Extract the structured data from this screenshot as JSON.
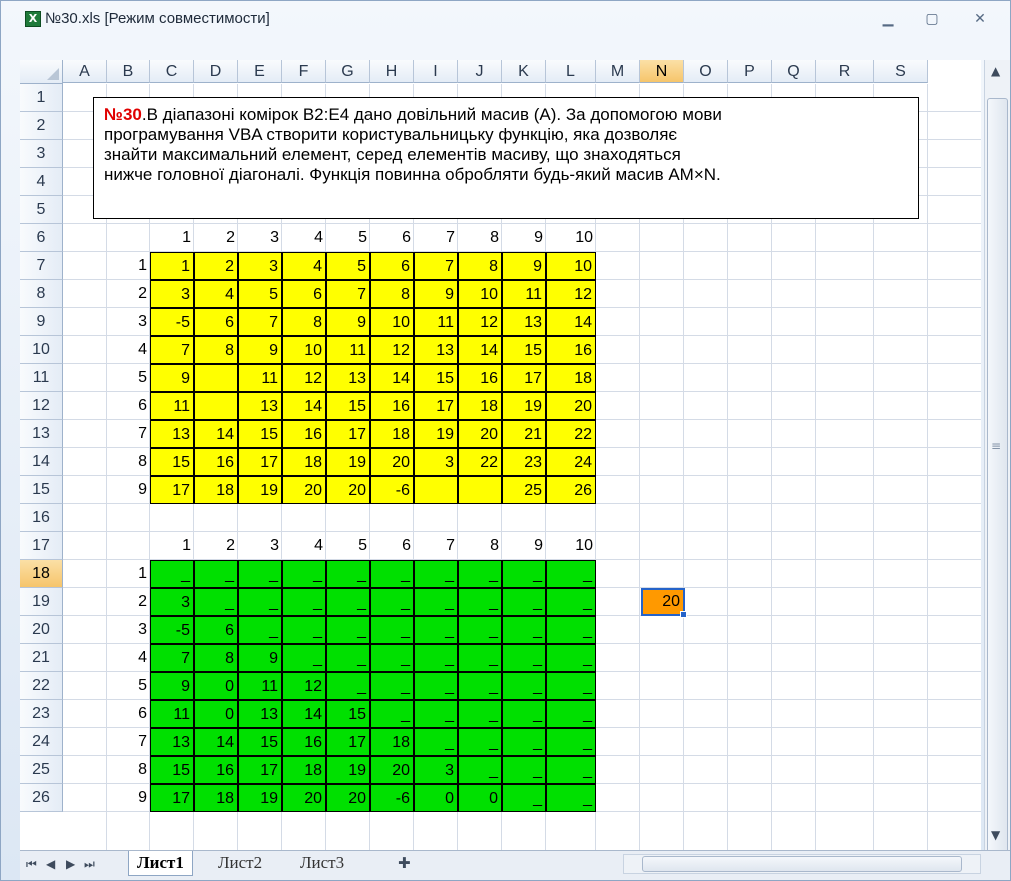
{
  "window": {
    "title": "№30.xls  [Режим совместимости]",
    "minimize_glyph": "▁",
    "maximize_glyph": "▢",
    "close_glyph": "✕"
  },
  "columns": [
    "A",
    "B",
    "C",
    "D",
    "E",
    "F",
    "G",
    "H",
    "I",
    "J",
    "K",
    "L",
    "M",
    "N",
    "O",
    "P",
    "Q",
    "R",
    "S"
  ],
  "rows": [
    "1",
    "2",
    "3",
    "4",
    "5",
    "6",
    "7",
    "8",
    "9",
    "10",
    "11",
    "12",
    "13",
    "14",
    "15",
    "16",
    "17",
    "18",
    "19",
    "20",
    "21",
    "22",
    "23",
    "24",
    "25",
    "26"
  ],
  "selected_column": "N",
  "selected_row": "18",
  "task": {
    "number": "№30",
    "text_line1": ".В діапазоні комірок B2:E4 дано довільний масив (A). За допомогою мови",
    "text_line2": "програмування VBA створити користувальницьку функцію, яка дозволяє",
    "text_line3": "знайти максимальний елемент, серед елементів масиву, що знаходяться",
    "text_line4": "нижче головної діагоналі. Функція повинна обробляти будь-який масив AM×N."
  },
  "table1": {
    "col_headers": [
      "1",
      "2",
      "3",
      "4",
      "5",
      "6",
      "7",
      "8",
      "9",
      "10"
    ],
    "row_headers": [
      "1",
      "2",
      "3",
      "4",
      "5",
      "6",
      "7",
      "8",
      "9"
    ],
    "cells": [
      [
        "1",
        "2",
        "3",
        "4",
        "5",
        "6",
        "7",
        "8",
        "9",
        "10"
      ],
      [
        "3",
        "4",
        "5",
        "6",
        "7",
        "8",
        "9",
        "10",
        "11",
        "12"
      ],
      [
        "-5",
        "6",
        "7",
        "8",
        "9",
        "10",
        "11",
        "12",
        "13",
        "14"
      ],
      [
        "7",
        "8",
        "9",
        "10",
        "11",
        "12",
        "13",
        "14",
        "15",
        "16"
      ],
      [
        "9",
        "",
        "11",
        "12",
        "13",
        "14",
        "15",
        "16",
        "17",
        "18"
      ],
      [
        "11",
        "",
        "13",
        "14",
        "15",
        "16",
        "17",
        "18",
        "19",
        "20"
      ],
      [
        "13",
        "14",
        "15",
        "16",
        "17",
        "18",
        "19",
        "20",
        "21",
        "22"
      ],
      [
        "15",
        "16",
        "17",
        "18",
        "19",
        "20",
        "3",
        "22",
        "23",
        "24"
      ],
      [
        "17",
        "18",
        "19",
        "20",
        "20",
        "-6",
        "",
        "",
        "25",
        "26"
      ]
    ]
  },
  "table2": {
    "col_headers": [
      "1",
      "2",
      "3",
      "4",
      "5",
      "6",
      "7",
      "8",
      "9",
      "10"
    ],
    "row_headers": [
      "1",
      "2",
      "3",
      "4",
      "5",
      "6",
      "7",
      "8",
      "9"
    ],
    "cells": [
      [
        "_",
        "_",
        "_",
        "_",
        "_",
        "_",
        "_",
        "_",
        "_",
        "_"
      ],
      [
        "3",
        "_",
        "_",
        "_",
        "_",
        "_",
        "_",
        "_",
        "_",
        "_"
      ],
      [
        "-5",
        "6",
        "_",
        "_",
        "_",
        "_",
        "_",
        "_",
        "_",
        "_"
      ],
      [
        "7",
        "8",
        "9",
        "_",
        "_",
        "_",
        "_",
        "_",
        "_",
        "_"
      ],
      [
        "9",
        "0",
        "11",
        "12",
        "_",
        "_",
        "_",
        "_",
        "_",
        "_"
      ],
      [
        "11",
        "0",
        "13",
        "14",
        "15",
        "_",
        "_",
        "_",
        "_",
        "_"
      ],
      [
        "13",
        "14",
        "15",
        "16",
        "17",
        "18",
        "_",
        "_",
        "_",
        "_"
      ],
      [
        "15",
        "16",
        "17",
        "18",
        "19",
        "20",
        "3",
        "_",
        "_",
        "_"
      ],
      [
        "17",
        "18",
        "19",
        "20",
        "20",
        "-6",
        "0",
        "0",
        "_",
        "_"
      ]
    ]
  },
  "result": {
    "value": "20"
  },
  "sheets": [
    "Лист1",
    "Лист2",
    "Лист3"
  ],
  "active_sheet": "Лист1",
  "colors": {
    "table1": "#ffff00",
    "table2": "#00e000",
    "result": "#ff9900",
    "task_number": "#e00000"
  }
}
